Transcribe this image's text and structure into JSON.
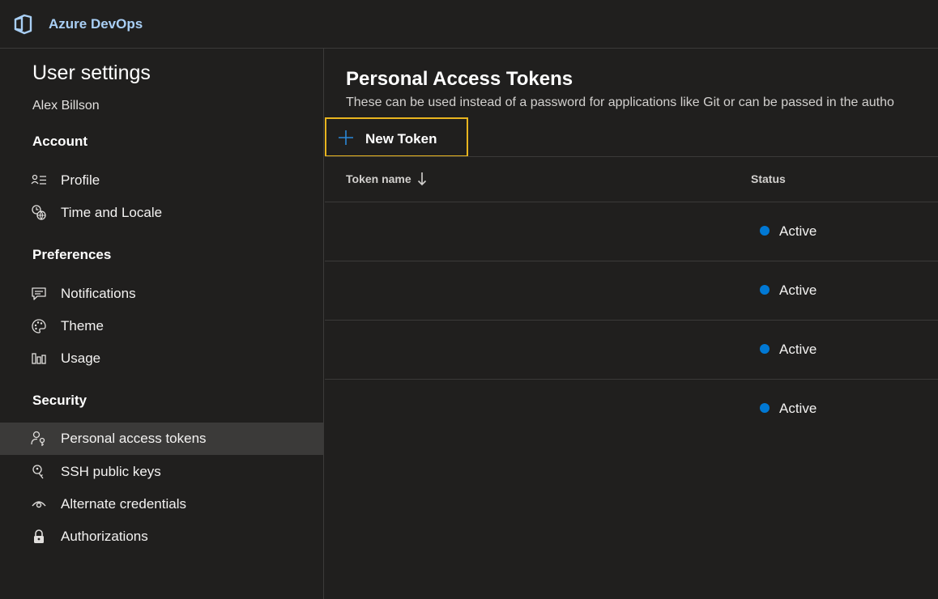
{
  "app": {
    "name": "Azure DevOps",
    "logo_icon": "azure-devops-logo-icon",
    "brand_color": "#a9cff5"
  },
  "sidebar": {
    "title": "User settings",
    "user_name": "Alex Billson",
    "sections": [
      {
        "label": "Account",
        "items": [
          {
            "label": "Profile",
            "icon": "profile-icon"
          },
          {
            "label": "Time and Locale",
            "icon": "globe-clock-icon"
          }
        ]
      },
      {
        "label": "Preferences",
        "items": [
          {
            "label": "Notifications",
            "icon": "notifications-icon"
          },
          {
            "label": "Theme",
            "icon": "palette-icon"
          },
          {
            "label": "Usage",
            "icon": "usage-chart-icon"
          }
        ]
      },
      {
        "label": "Security",
        "items": [
          {
            "label": "Personal access tokens",
            "icon": "person-key-icon",
            "selected": true
          },
          {
            "label": "SSH public keys",
            "icon": "ssh-key-icon"
          },
          {
            "label": "Alternate credentials",
            "icon": "eye-icon"
          },
          {
            "label": "Authorizations",
            "icon": "lock-icon"
          }
        ]
      }
    ]
  },
  "main": {
    "title": "Personal Access Tokens",
    "description": "These can be used instead of a password for applications like Git or can be passed in the autho",
    "new_token_label": "New Token",
    "columns": {
      "name": "Token name",
      "status": "Status"
    },
    "sort": {
      "column": "Token name",
      "direction": "descending",
      "icon": "arrow-down-icon"
    },
    "rows": [
      {
        "name": "",
        "status": "Active"
      },
      {
        "name": "",
        "status": "Active"
      },
      {
        "name": "",
        "status": "Active"
      },
      {
        "name": "",
        "status": "Active"
      }
    ],
    "status_color": "#0078d4",
    "highlight_color": "#e8b51f"
  }
}
